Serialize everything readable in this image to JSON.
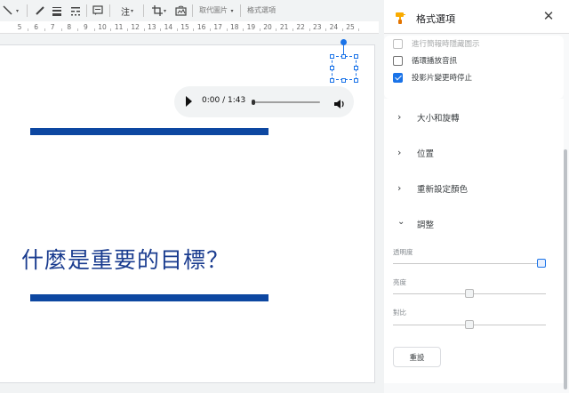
{
  "toolbar": {
    "image_options_label": "取代圖片",
    "format_options_label": "格式選項",
    "bullet_label": "注",
    "icons": [
      "line-icon",
      "pen-icon",
      "line-weight-icon",
      "line-dash-icon",
      "comment-icon",
      "crop-icon",
      "image-reset-icon"
    ]
  },
  "ruler": {
    "ticks": [
      "5",
      "6",
      "7",
      "8",
      "9",
      "10",
      "11",
      "12",
      "13",
      "14",
      "15",
      "16",
      "17",
      "18",
      "19",
      "20",
      "21",
      "22",
      "23",
      "24",
      "25"
    ]
  },
  "slide": {
    "title": "什麼是重要的目標？",
    "audio_time": "0:00 / 1:43",
    "accent_color": "#0d47a1",
    "title_color": "#1a3c8f"
  },
  "panel": {
    "title": "格式選項",
    "checkboxes": [
      {
        "label": "進行簡報時隱藏圖示",
        "checked": false,
        "faded": true
      },
      {
        "label": "循環播放音訊",
        "checked": false,
        "faded": false
      },
      {
        "label": "投影片變更時停止",
        "checked": true,
        "faded": false
      }
    ],
    "sections": [
      {
        "label": "大小和旋轉",
        "expanded": false
      },
      {
        "label": "位置",
        "expanded": false
      },
      {
        "label": "重新設定顏色",
        "expanded": false
      },
      {
        "label": "調整",
        "expanded": true
      }
    ],
    "adjustments": [
      {
        "label": "透明度",
        "value": 1.0
      },
      {
        "label": "亮度",
        "value": 0.5
      },
      {
        "label": "對比",
        "value": 0.5
      }
    ],
    "reset_label": "重設",
    "accent_color": "#1a73e8"
  }
}
